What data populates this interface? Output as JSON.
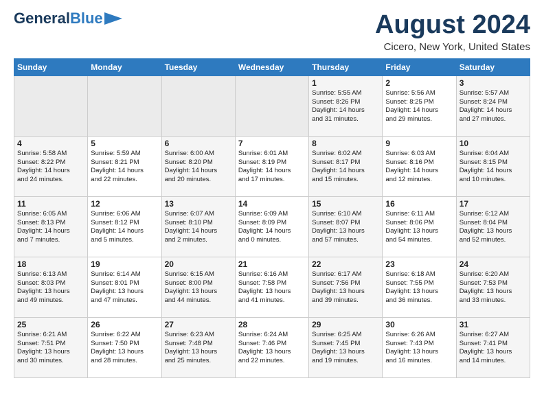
{
  "logo": {
    "line1": "General",
    "line2": "Blue"
  },
  "title": "August 2024",
  "location": "Cicero, New York, United States",
  "weekdays": [
    "Sunday",
    "Monday",
    "Tuesday",
    "Wednesday",
    "Thursday",
    "Friday",
    "Saturday"
  ],
  "weeks": [
    [
      {
        "day": "",
        "text": ""
      },
      {
        "day": "",
        "text": ""
      },
      {
        "day": "",
        "text": ""
      },
      {
        "day": "",
        "text": ""
      },
      {
        "day": "1",
        "text": "Sunrise: 5:55 AM\nSunset: 8:26 PM\nDaylight: 14 hours\nand 31 minutes."
      },
      {
        "day": "2",
        "text": "Sunrise: 5:56 AM\nSunset: 8:25 PM\nDaylight: 14 hours\nand 29 minutes."
      },
      {
        "day": "3",
        "text": "Sunrise: 5:57 AM\nSunset: 8:24 PM\nDaylight: 14 hours\nand 27 minutes."
      }
    ],
    [
      {
        "day": "4",
        "text": "Sunrise: 5:58 AM\nSunset: 8:22 PM\nDaylight: 14 hours\nand 24 minutes."
      },
      {
        "day": "5",
        "text": "Sunrise: 5:59 AM\nSunset: 8:21 PM\nDaylight: 14 hours\nand 22 minutes."
      },
      {
        "day": "6",
        "text": "Sunrise: 6:00 AM\nSunset: 8:20 PM\nDaylight: 14 hours\nand 20 minutes."
      },
      {
        "day": "7",
        "text": "Sunrise: 6:01 AM\nSunset: 8:19 PM\nDaylight: 14 hours\nand 17 minutes."
      },
      {
        "day": "8",
        "text": "Sunrise: 6:02 AM\nSunset: 8:17 PM\nDaylight: 14 hours\nand 15 minutes."
      },
      {
        "day": "9",
        "text": "Sunrise: 6:03 AM\nSunset: 8:16 PM\nDaylight: 14 hours\nand 12 minutes."
      },
      {
        "day": "10",
        "text": "Sunrise: 6:04 AM\nSunset: 8:15 PM\nDaylight: 14 hours\nand 10 minutes."
      }
    ],
    [
      {
        "day": "11",
        "text": "Sunrise: 6:05 AM\nSunset: 8:13 PM\nDaylight: 14 hours\nand 7 minutes."
      },
      {
        "day": "12",
        "text": "Sunrise: 6:06 AM\nSunset: 8:12 PM\nDaylight: 14 hours\nand 5 minutes."
      },
      {
        "day": "13",
        "text": "Sunrise: 6:07 AM\nSunset: 8:10 PM\nDaylight: 14 hours\nand 2 minutes."
      },
      {
        "day": "14",
        "text": "Sunrise: 6:09 AM\nSunset: 8:09 PM\nDaylight: 14 hours\nand 0 minutes."
      },
      {
        "day": "15",
        "text": "Sunrise: 6:10 AM\nSunset: 8:07 PM\nDaylight: 13 hours\nand 57 minutes."
      },
      {
        "day": "16",
        "text": "Sunrise: 6:11 AM\nSunset: 8:06 PM\nDaylight: 13 hours\nand 54 minutes."
      },
      {
        "day": "17",
        "text": "Sunrise: 6:12 AM\nSunset: 8:04 PM\nDaylight: 13 hours\nand 52 minutes."
      }
    ],
    [
      {
        "day": "18",
        "text": "Sunrise: 6:13 AM\nSunset: 8:03 PM\nDaylight: 13 hours\nand 49 minutes."
      },
      {
        "day": "19",
        "text": "Sunrise: 6:14 AM\nSunset: 8:01 PM\nDaylight: 13 hours\nand 47 minutes."
      },
      {
        "day": "20",
        "text": "Sunrise: 6:15 AM\nSunset: 8:00 PM\nDaylight: 13 hours\nand 44 minutes."
      },
      {
        "day": "21",
        "text": "Sunrise: 6:16 AM\nSunset: 7:58 PM\nDaylight: 13 hours\nand 41 minutes."
      },
      {
        "day": "22",
        "text": "Sunrise: 6:17 AM\nSunset: 7:56 PM\nDaylight: 13 hours\nand 39 minutes."
      },
      {
        "day": "23",
        "text": "Sunrise: 6:18 AM\nSunset: 7:55 PM\nDaylight: 13 hours\nand 36 minutes."
      },
      {
        "day": "24",
        "text": "Sunrise: 6:20 AM\nSunset: 7:53 PM\nDaylight: 13 hours\nand 33 minutes."
      }
    ],
    [
      {
        "day": "25",
        "text": "Sunrise: 6:21 AM\nSunset: 7:51 PM\nDaylight: 13 hours\nand 30 minutes."
      },
      {
        "day": "26",
        "text": "Sunrise: 6:22 AM\nSunset: 7:50 PM\nDaylight: 13 hours\nand 28 minutes."
      },
      {
        "day": "27",
        "text": "Sunrise: 6:23 AM\nSunset: 7:48 PM\nDaylight: 13 hours\nand 25 minutes."
      },
      {
        "day": "28",
        "text": "Sunrise: 6:24 AM\nSunset: 7:46 PM\nDaylight: 13 hours\nand 22 minutes."
      },
      {
        "day": "29",
        "text": "Sunrise: 6:25 AM\nSunset: 7:45 PM\nDaylight: 13 hours\nand 19 minutes."
      },
      {
        "day": "30",
        "text": "Sunrise: 6:26 AM\nSunset: 7:43 PM\nDaylight: 13 hours\nand 16 minutes."
      },
      {
        "day": "31",
        "text": "Sunrise: 6:27 AM\nSunset: 7:41 PM\nDaylight: 13 hours\nand 14 minutes."
      }
    ]
  ]
}
